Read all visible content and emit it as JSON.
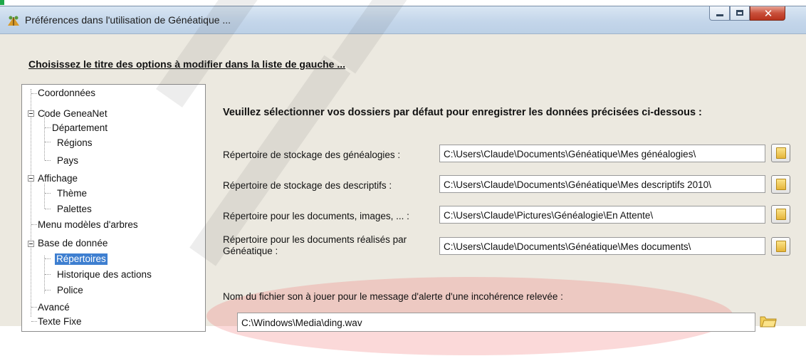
{
  "window": {
    "title": "Préférences dans l'utilisation de Généatique ..."
  },
  "instruction": "Choisissez le titre des options à modifier dans la liste de gauche ...",
  "tree": {
    "items": [
      {
        "label": "Coordonnées"
      },
      {
        "label": "Code GeneaNet"
      },
      {
        "label": "Département"
      },
      {
        "label": "Régions"
      },
      {
        "label": "Pays"
      },
      {
        "label": "Affichage"
      },
      {
        "label": "Thème"
      },
      {
        "label": "Palettes"
      },
      {
        "label": "Menu modèles d'arbres"
      },
      {
        "label": "Base de donnée"
      },
      {
        "label": "Répertoires",
        "selected": true
      },
      {
        "label": "Historique des actions"
      },
      {
        "label": "Police"
      },
      {
        "label": "Avancé"
      },
      {
        "label": "Texte Fixe"
      }
    ]
  },
  "content": {
    "title": "Veuillez sélectionner vos dossiers par défaut pour enregistrer les données précisées ci-dessous :",
    "rows": [
      {
        "label": "Répertoire de stockage des généalogies :",
        "value": "C:\\Users\\Claude\\Documents\\Généatique\\Mes généalogies\\"
      },
      {
        "label": "Répertoire de stockage des descriptifs :",
        "value": "C:\\Users\\Claude\\Documents\\Généatique\\Mes descriptifs 2010\\"
      },
      {
        "label": "Répertoire pour les documents, images, ... :",
        "value": "C:\\Users\\Claude\\Pictures\\Généalogie\\En Attente\\"
      },
      {
        "label_line1": "Répertoire pour les documents réalisés par",
        "label_line2": "Généatique :",
        "value": "C:\\Users\\Claude\\Documents\\Généatique\\Mes documents\\"
      }
    ],
    "sound_label": "Nom du fichier son à jouer pour le message d'alerte d'une incohérence relevée :",
    "sound_value": "C:\\Windows\\Media\\ding.wav"
  },
  "icons": {
    "app": "tree-app-icon",
    "browse": "folder-icon",
    "minimize": "minimize-icon",
    "maximize": "maximize-icon",
    "close": "close-icon"
  },
  "colors": {
    "selection": "#3e7fd0",
    "highlight": "#f07878",
    "close_button": "#c9503b"
  }
}
